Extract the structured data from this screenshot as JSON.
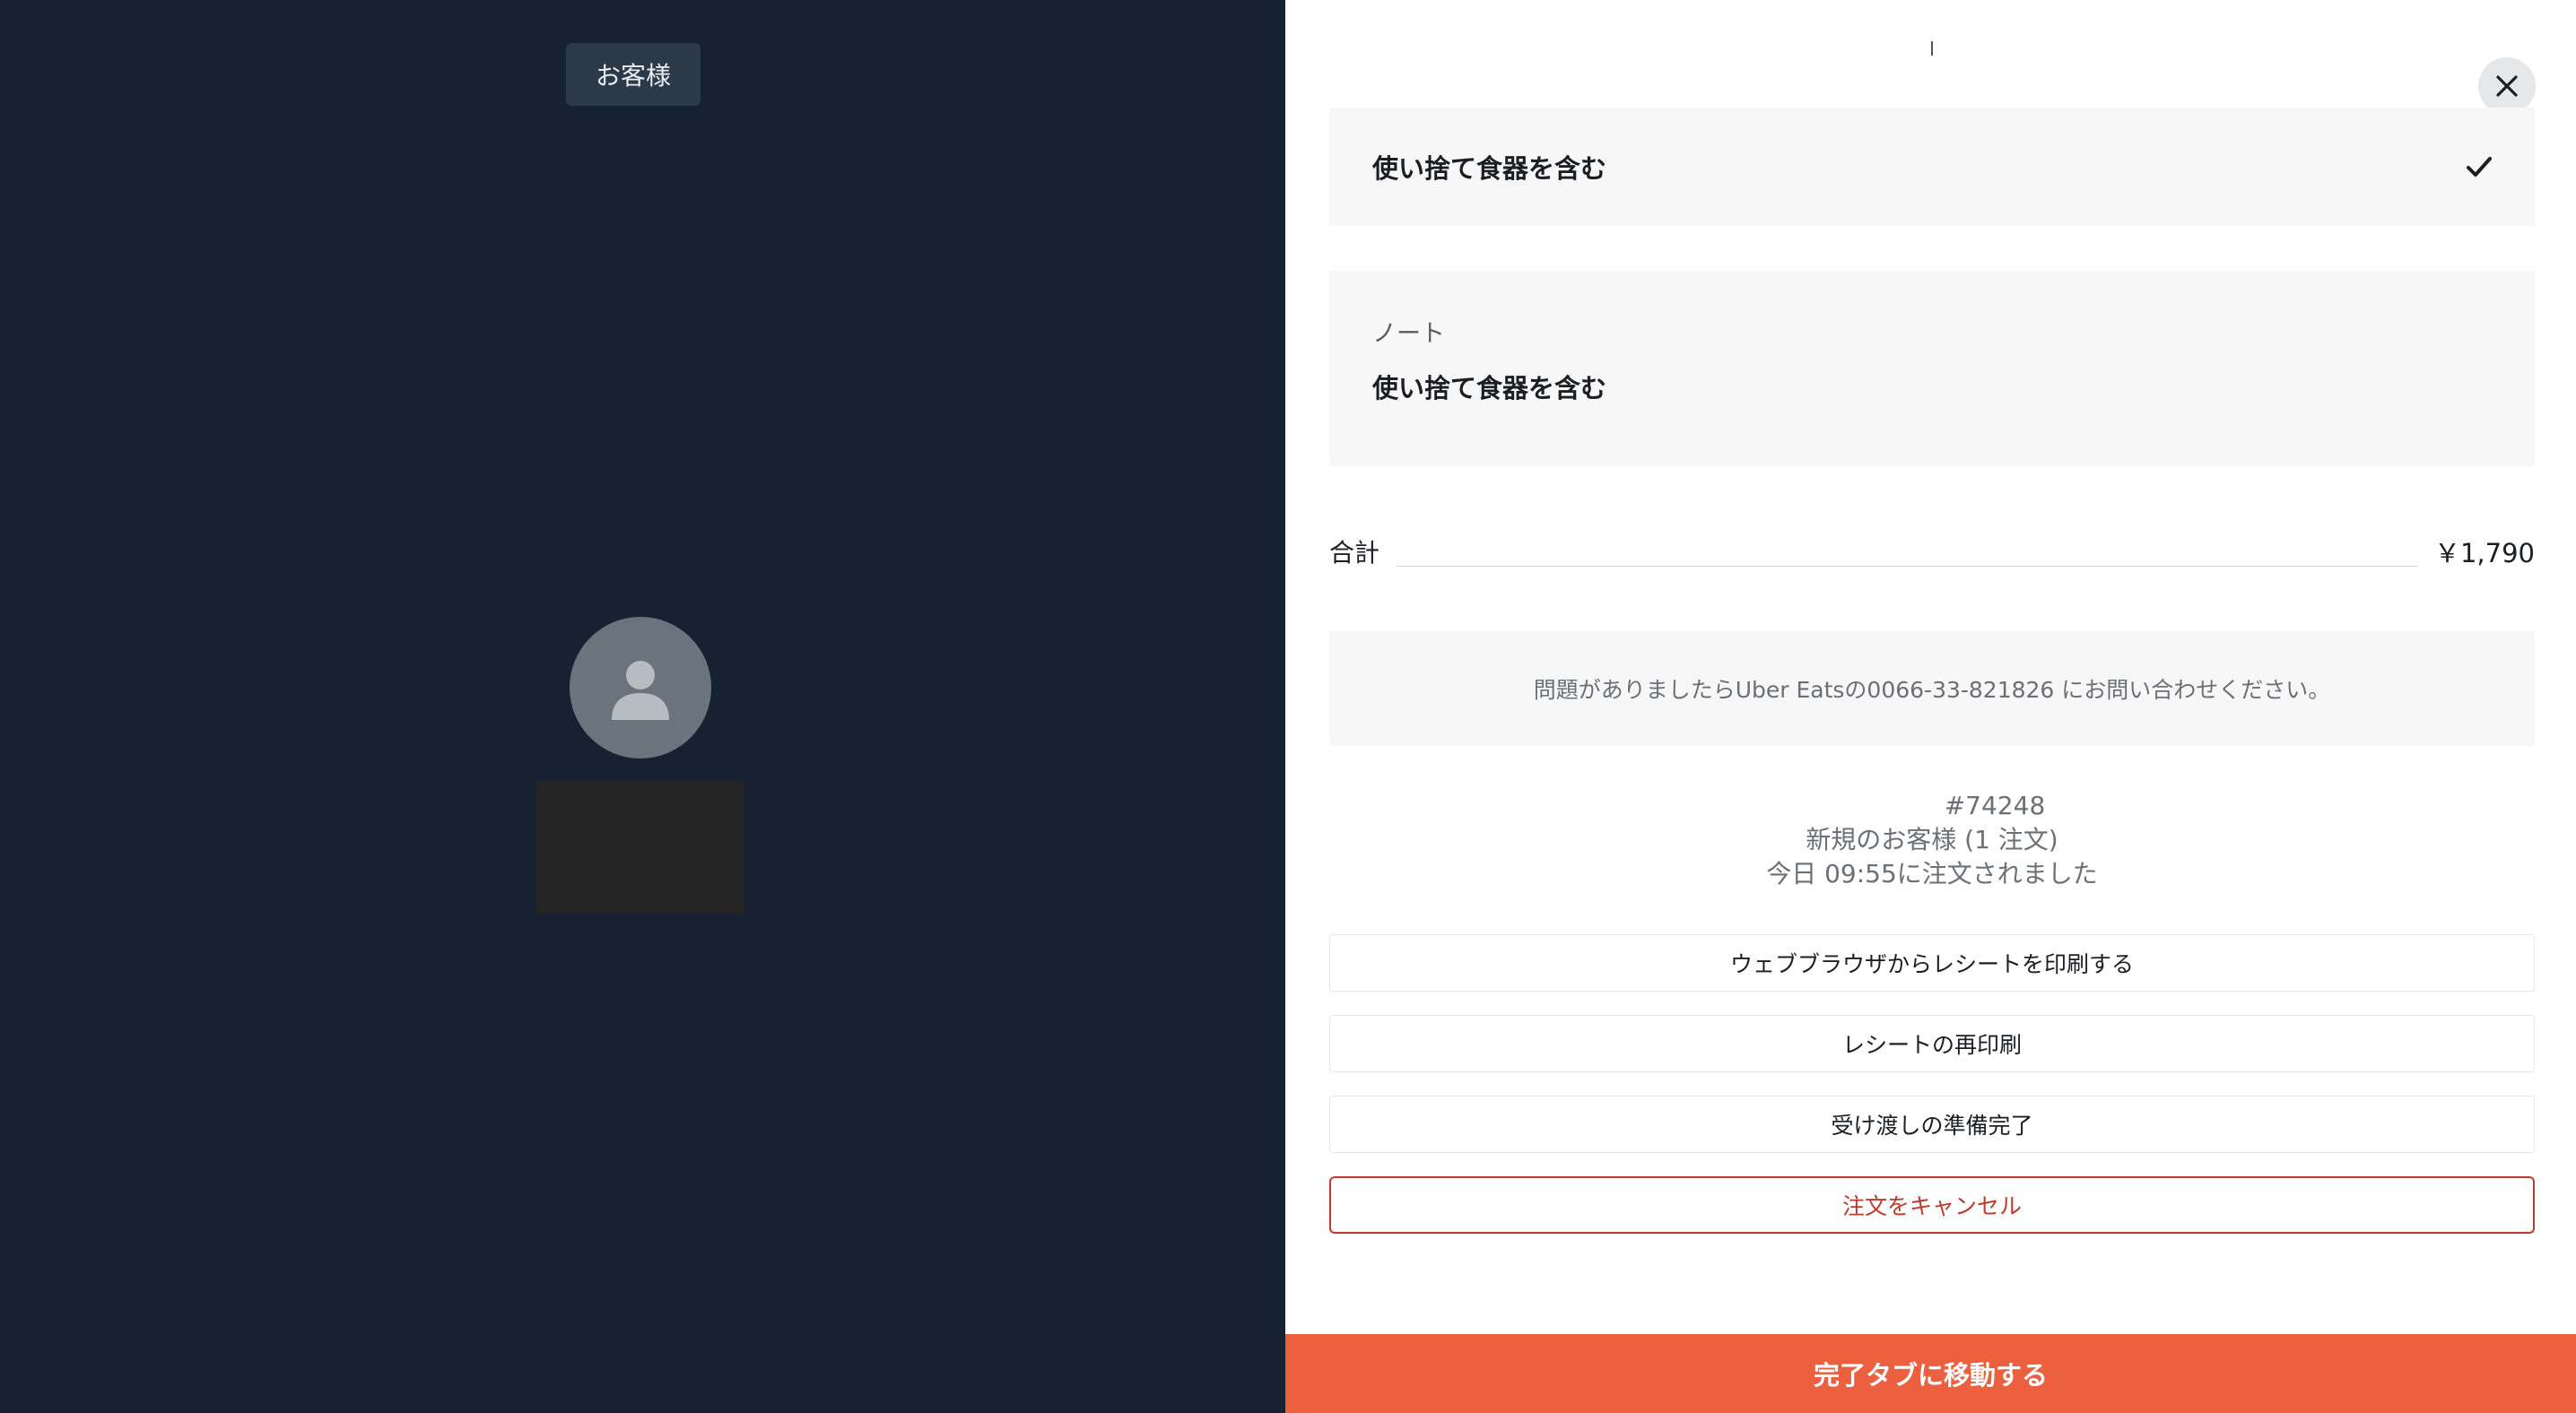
{
  "left_panel": {
    "customer_chip": "お客様",
    "avatar_icon": "person-icon"
  },
  "right_panel": {
    "close_icon": "close-icon",
    "utensils": {
      "label": "使い捨て食器を含む",
      "check_icon": "checkmark-icon"
    },
    "note": {
      "label": "ノート",
      "text": "使い捨て食器を含む"
    },
    "total": {
      "label": "合計",
      "value": "￥1,790"
    },
    "contact": {
      "text": "問題がありましたらUber Eatsの0066-33-821826 にお問い合わせください。"
    },
    "order": {
      "id": "#74248",
      "customer_status": "新規のお客様 (1 注文)",
      "ordered_at": "今日 09:55に注文されました"
    },
    "buttons": {
      "print_web": "ウェブブラウザからレシートを印刷する",
      "reprint": "レシートの再印刷",
      "ready": "受け渡しの準備完了",
      "cancel": "注文をキャンセル"
    },
    "bottom_bar": "完了タブに移動する"
  },
  "colors": {
    "left_bg": "#162232",
    "accent": "#ec6040",
    "cancel": "#c0392b"
  }
}
